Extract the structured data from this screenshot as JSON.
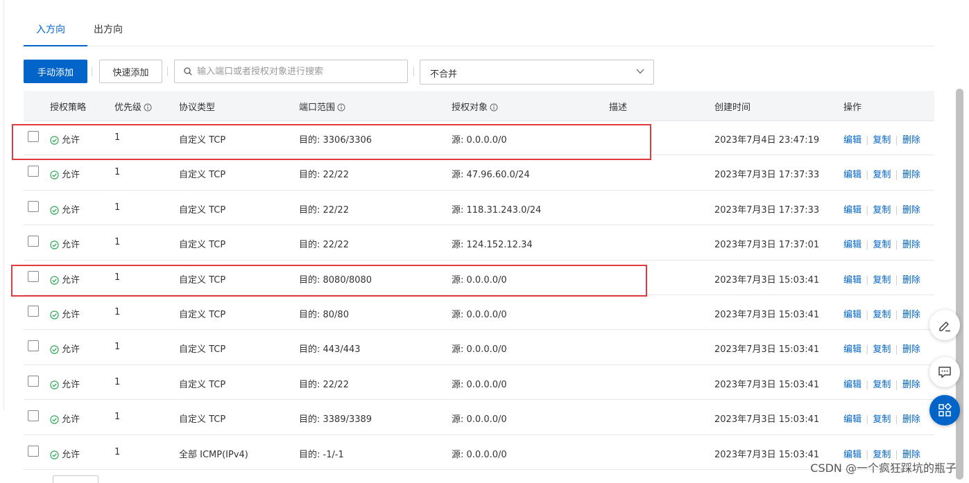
{
  "tabs": [
    {
      "label": "入方向",
      "active": true
    },
    {
      "label": "出方向",
      "active": false
    }
  ],
  "toolbar": {
    "manual_add": "手动添加",
    "quick_add": "快速添加",
    "search_placeholder": "输入端口或者授权对象进行搜索",
    "merge_select": "不合并"
  },
  "columns": [
    "授权策略",
    "优先级",
    "协议类型",
    "端口范围",
    "授权对象",
    "描述",
    "创建时间",
    "操作"
  ],
  "rows": [
    {
      "policy": "允许",
      "priority": "1",
      "protocol": "自定义 TCP",
      "port": "目的: 3306/3306",
      "source": "源: 0.0.0.0/0",
      "desc": "",
      "created": "2023年7月4日 23:47:19"
    },
    {
      "policy": "允许",
      "priority": "1",
      "protocol": "自定义 TCP",
      "port": "目的: 22/22",
      "source": "源: 47.96.60.0/24",
      "desc": "",
      "created": "2023年7月3日 17:37:33"
    },
    {
      "policy": "允许",
      "priority": "1",
      "protocol": "自定义 TCP",
      "port": "目的: 22/22",
      "source": "源: 118.31.243.0/24",
      "desc": "",
      "created": "2023年7月3日 17:37:33"
    },
    {
      "policy": "允许",
      "priority": "1",
      "protocol": "自定义 TCP",
      "port": "目的: 22/22",
      "source": "源: 124.152.12.34",
      "desc": "",
      "created": "2023年7月3日 17:37:01"
    },
    {
      "policy": "允许",
      "priority": "1",
      "protocol": "自定义 TCP",
      "port": "目的: 8080/8080",
      "source": "源: 0.0.0.0/0",
      "desc": "",
      "created": "2023年7月3日 15:03:41"
    },
    {
      "policy": "允许",
      "priority": "1",
      "protocol": "自定义 TCP",
      "port": "目的: 80/80",
      "source": "源: 0.0.0.0/0",
      "desc": "",
      "created": "2023年7月3日 15:03:41"
    },
    {
      "policy": "允许",
      "priority": "1",
      "protocol": "自定义 TCP",
      "port": "目的: 443/443",
      "source": "源: 0.0.0.0/0",
      "desc": "",
      "created": "2023年7月3日 15:03:41"
    },
    {
      "policy": "允许",
      "priority": "1",
      "protocol": "自定义 TCP",
      "port": "目的: 22/22",
      "source": "源: 0.0.0.0/0",
      "desc": "",
      "created": "2023年7月3日 15:03:41"
    },
    {
      "policy": "允许",
      "priority": "1",
      "protocol": "自定义 TCP",
      "port": "目的: 3389/3389",
      "source": "源: 0.0.0.0/0",
      "desc": "",
      "created": "2023年7月3日 15:03:41"
    },
    {
      "policy": "允许",
      "priority": "1",
      "protocol": "全部 ICMP(IPv4)",
      "port": "目的: -1/-1",
      "source": "源: 0.0.0.0/0",
      "desc": "",
      "created": "2023年7月3日 15:03:41"
    }
  ],
  "row_actions": {
    "edit": "编辑",
    "copy": "复制",
    "delete": "删除"
  },
  "highlighted_rows": [
    0,
    4
  ],
  "watermark": "CSDN @一个疯狂踩坑的瓶子",
  "colors": {
    "primary": "#0064c8",
    "success": "#1fa44b",
    "highlight": "#e0393e",
    "header_bg": "#f4f5f7"
  },
  "icons": {
    "info": "info-icon",
    "check": "check-circle-icon",
    "search": "search-icon",
    "dropdown": "chevron-down-icon",
    "floating": [
      "edit-icon",
      "feedback-icon",
      "apps-icon"
    ]
  }
}
